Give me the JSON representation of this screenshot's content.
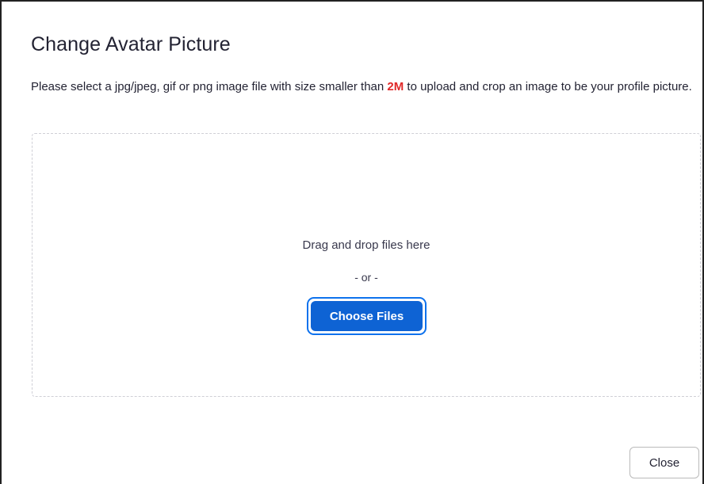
{
  "dialog": {
    "title": "Change Avatar Picture",
    "instructions": {
      "before": "Please select a jpg/jpeg, gif or png image file with size smaller than ",
      "size_limit": "2M",
      "after": " to upload and crop an image to be your profile picture."
    },
    "size_limit_color": "#e02828",
    "drop_zone": {
      "drag_text": "Drag and drop files here",
      "or_text": "- or -",
      "choose_label": "Choose Files"
    },
    "accent_color": "#0e63d4",
    "close_label": "Close"
  }
}
